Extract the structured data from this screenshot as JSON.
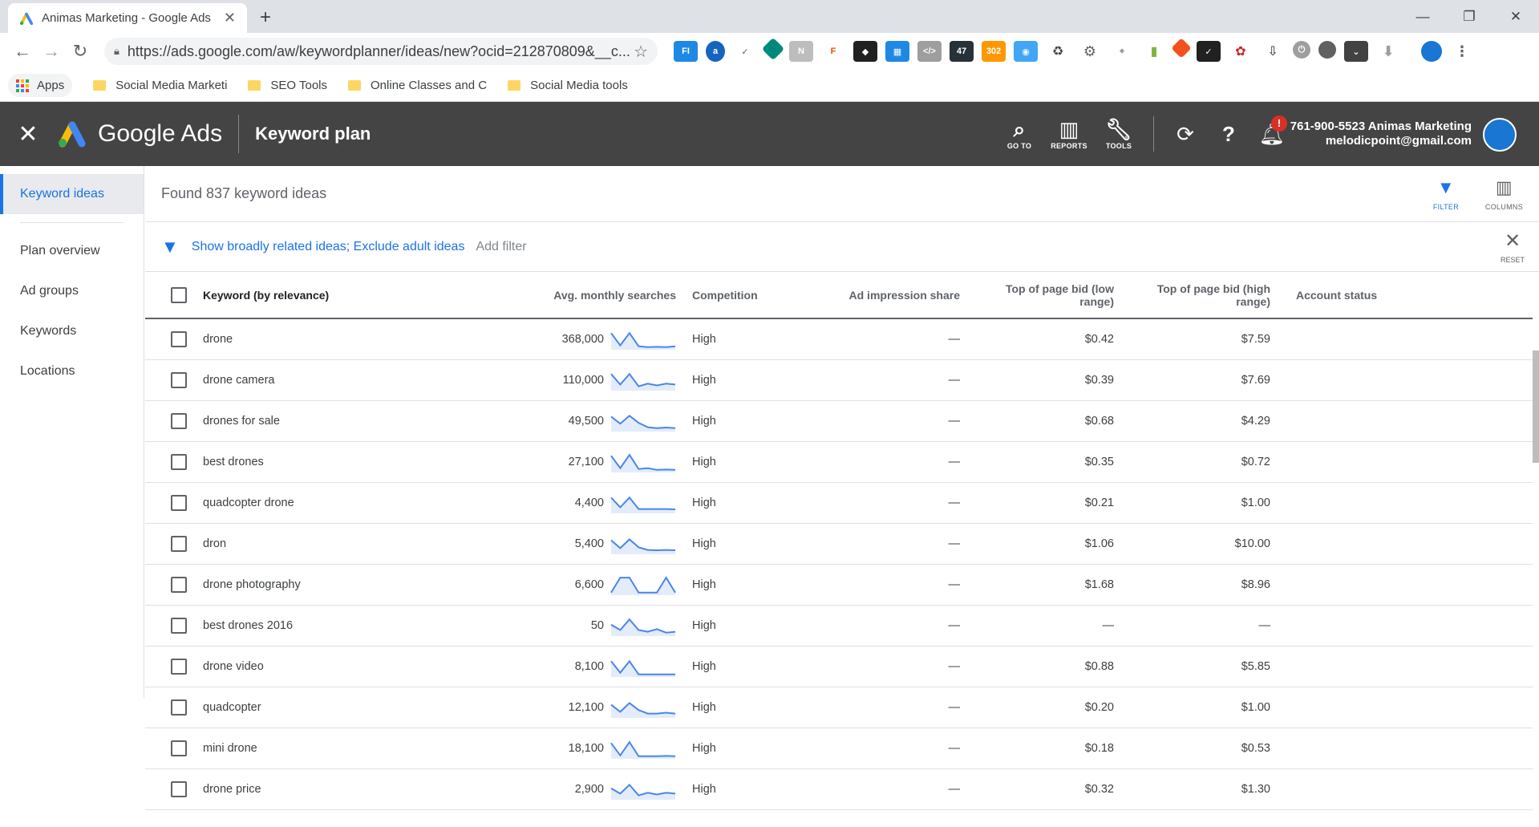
{
  "browser": {
    "tab_title": "Animas Marketing - Google Ads",
    "url": "https://ads.google.com/aw/keywordplanner/ideas/new?ocid=212870809&__c...",
    "bookmarks": [
      "Apps",
      "Social Media Marketi",
      "SEO Tools",
      "Online Classes and C",
      "Social Media tools"
    ],
    "extension_badges": [
      "47",
      "302"
    ]
  },
  "header": {
    "brand": "Google Ads",
    "title": "Keyword plan",
    "goto_label": "GO TO",
    "reports_label": "REPORTS",
    "tools_label": "TOOLS",
    "notification_badge": "!",
    "account_name": "761-900-5523 Animas Marketing",
    "account_email": "melodicpoint@gmail.com"
  },
  "sidebar": {
    "items": [
      {
        "label": "Keyword ideas"
      },
      {
        "label": "Plan overview"
      },
      {
        "label": "Ad groups"
      },
      {
        "label": "Keywords"
      },
      {
        "label": "Locations"
      }
    ]
  },
  "main": {
    "found_text": "Found 837 keyword ideas",
    "filter_label": "FILTER",
    "columns_label": "COLUMNS",
    "filter_text": "Show broadly related ideas; Exclude adult ideas",
    "add_filter": "Add filter",
    "reset_label": "RESET"
  },
  "table": {
    "headers": {
      "keyword": "Keyword (by relevance)",
      "avg": "Avg. monthly searches",
      "competition": "Competition",
      "impression": "Ad impression share",
      "low_1": "Top of page bid (low",
      "low_2": "range)",
      "high_1": "Top of page bid (high",
      "high_2": "range)",
      "status": "Account status"
    },
    "rows": [
      {
        "keyword": "drone",
        "avg": "368,000",
        "competition": "High",
        "impression": "—",
        "low": "$0.42",
        "high": "$7.59",
        "trend": [
          0.9,
          0.2,
          0.9,
          0.15,
          0.1,
          0.12,
          0.1,
          0.15
        ]
      },
      {
        "keyword": "drone camera",
        "avg": "110,000",
        "competition": "High",
        "impression": "—",
        "low": "$0.39",
        "high": "$7.69",
        "trend": [
          0.9,
          0.3,
          0.9,
          0.2,
          0.35,
          0.25,
          0.35,
          0.3
        ]
      },
      {
        "keyword": "drones for sale",
        "avg": "49,500",
        "competition": "High",
        "impression": "—",
        "low": "$0.68",
        "high": "$4.29",
        "trend": [
          0.8,
          0.4,
          0.85,
          0.45,
          0.2,
          0.15,
          0.18,
          0.15
        ]
      },
      {
        "keyword": "best drones",
        "avg": "27,100",
        "competition": "High",
        "impression": "—",
        "low": "$0.35",
        "high": "$0.72",
        "trend": [
          0.9,
          0.2,
          0.95,
          0.15,
          0.2,
          0.1,
          0.12,
          0.1
        ]
      },
      {
        "keyword": "quadcopter drone",
        "avg": "4,400",
        "competition": "High",
        "impression": "—",
        "low": "$0.21",
        "high": "$1.00",
        "trend": [
          0.85,
          0.3,
          0.85,
          0.2,
          0.2,
          0.2,
          0.2,
          0.18
        ]
      },
      {
        "keyword": "dron",
        "avg": "5,400",
        "competition": "High",
        "impression": "—",
        "low": "$1.06",
        "high": "$10.00",
        "trend": [
          0.75,
          0.3,
          0.8,
          0.35,
          0.2,
          0.18,
          0.2,
          0.18
        ]
      },
      {
        "keyword": "drone photography",
        "avg": "6,600",
        "competition": "High",
        "impression": "—",
        "low": "$1.68",
        "high": "$8.96",
        "trend": [
          0.1,
          0.95,
          0.95,
          0.1,
          0.1,
          0.1,
          0.95,
          0.1
        ]
      },
      {
        "keyword": "best drones 2016",
        "avg": "50",
        "competition": "High",
        "impression": "—",
        "low": "—",
        "high": "—",
        "trend": [
          0.6,
          0.3,
          0.9,
          0.3,
          0.2,
          0.35,
          0.15,
          0.2
        ]
      },
      {
        "keyword": "drone video",
        "avg": "8,100",
        "competition": "High",
        "impression": "—",
        "low": "$0.88",
        "high": "$5.85",
        "trend": [
          0.85,
          0.2,
          0.85,
          0.1,
          0.1,
          0.1,
          0.1,
          0.1
        ]
      },
      {
        "keyword": "quadcopter",
        "avg": "12,100",
        "competition": "High",
        "impression": "—",
        "low": "$0.20",
        "high": "$1.00",
        "trend": [
          0.7,
          0.3,
          0.8,
          0.4,
          0.2,
          0.2,
          0.25,
          0.2
        ]
      },
      {
        "keyword": "mini drone",
        "avg": "18,100",
        "competition": "High",
        "impression": "—",
        "low": "$0.18",
        "high": "$0.53",
        "trend": [
          0.85,
          0.15,
          0.9,
          0.1,
          0.1,
          0.1,
          0.12,
          0.1
        ]
      },
      {
        "keyword": "drone price",
        "avg": "2,900",
        "competition": "High",
        "impression": "—",
        "low": "$0.32",
        "high": "$1.30",
        "trend": [
          0.6,
          0.3,
          0.8,
          0.2,
          0.35,
          0.25,
          0.35,
          0.3
        ]
      }
    ]
  },
  "colors": {
    "accent": "#1a73e8",
    "header_bg": "#444444",
    "spark_line": "#4a86e8",
    "spark_fill": "#e3ecfa"
  }
}
